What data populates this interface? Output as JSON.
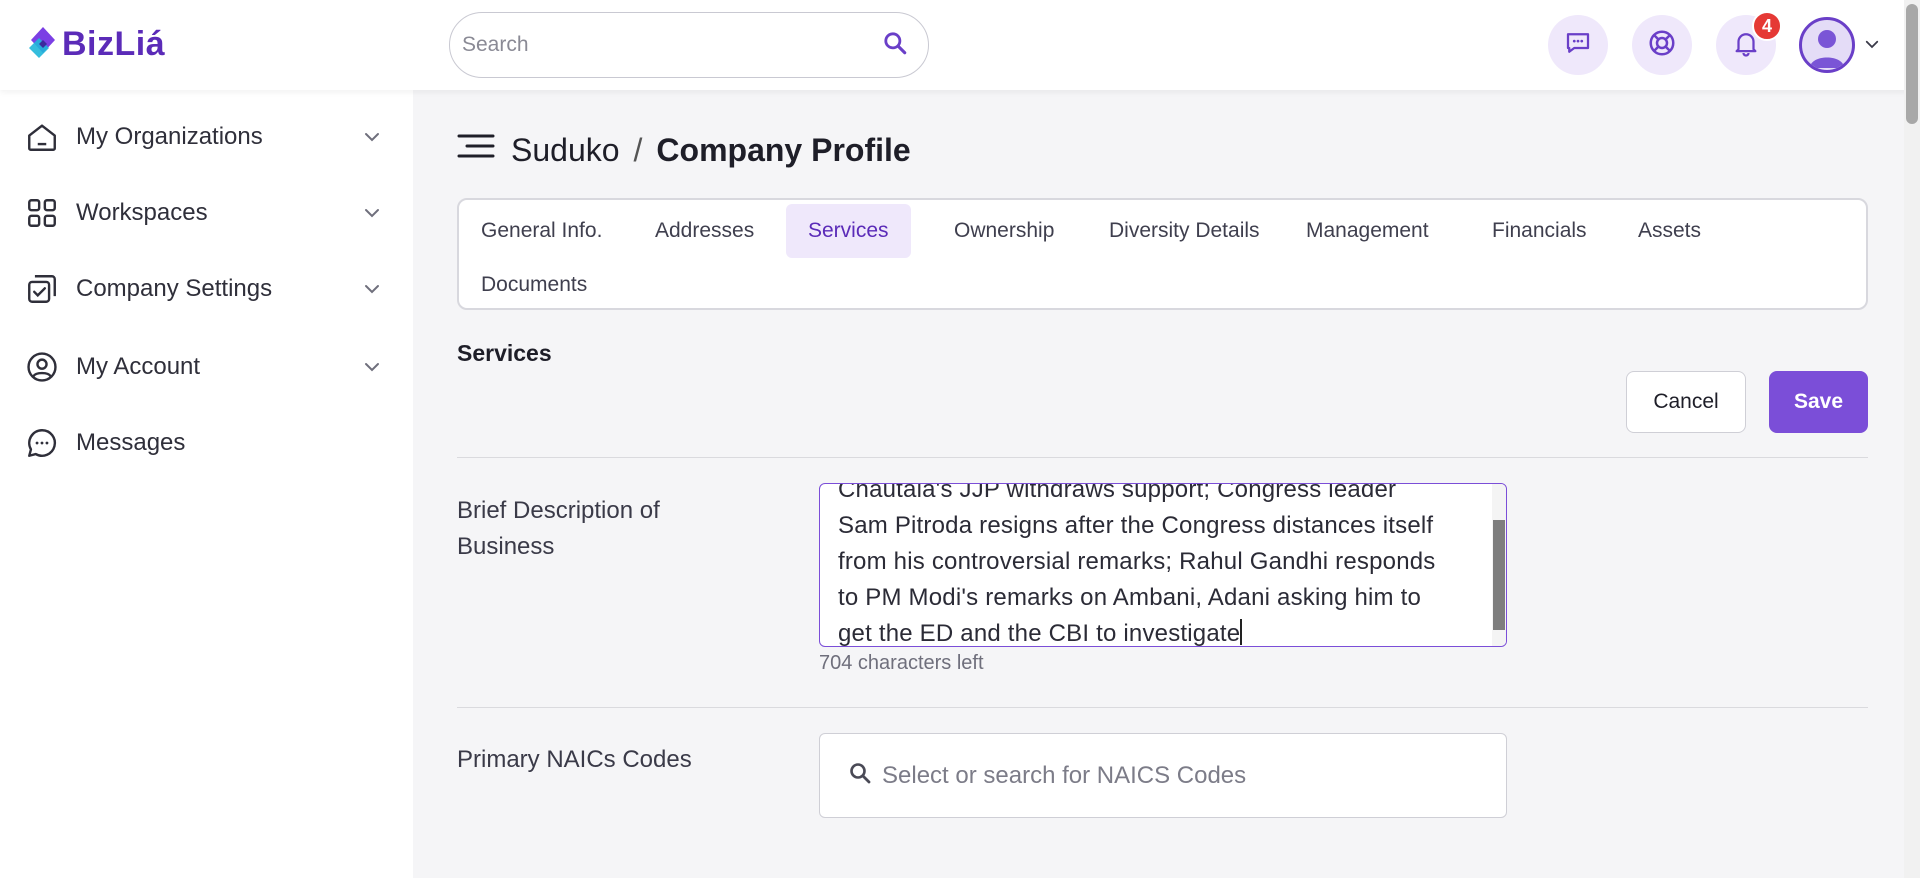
{
  "header": {
    "logo_text": "BizLiá",
    "search": {
      "placeholder": "Search",
      "value": ""
    },
    "notifications_count": "4",
    "icons": [
      "chat-icon",
      "support-icon",
      "bell-icon",
      "user-avatar",
      "chevron-down-icon"
    ]
  },
  "sidebar": {
    "items": [
      {
        "label": "My Organizations",
        "icon": "home-icon",
        "expandable": true
      },
      {
        "label": "Workspaces",
        "icon": "grid-icon",
        "expandable": true
      },
      {
        "label": "Company Settings",
        "icon": "settings-check-icon",
        "expandable": true
      },
      {
        "label": "My Account",
        "icon": "user-circle-icon",
        "expandable": true
      },
      {
        "label": "Messages",
        "icon": "message-icon",
        "expandable": false
      }
    ]
  },
  "breadcrumb": {
    "parent": "Suduko",
    "separator": "/",
    "current": "Company Profile"
  },
  "tabs": [
    {
      "label": "General Info.",
      "active": false
    },
    {
      "label": "Addresses",
      "active": false
    },
    {
      "label": "Services",
      "active": true
    },
    {
      "label": "Ownership",
      "active": false
    },
    {
      "label": "Diversity Details",
      "active": false
    },
    {
      "label": "Management",
      "active": false
    },
    {
      "label": "Financials",
      "active": false
    },
    {
      "label": "Assets",
      "active": false
    },
    {
      "label": "Documents",
      "active": false
    }
  ],
  "section": {
    "title": "Services",
    "cancel_label": "Cancel",
    "save_label": "Save"
  },
  "form": {
    "brief_label_line1": "Brief Description of",
    "brief_label_line2": "Business",
    "brief_lines": [
      "Chautala's JJP withdraws support; Congress leader",
      "Sam Pitroda resigns after the Congress distances itself",
      "from his controversial remarks; Rahul Gandhi responds",
      "to PM Modi's remarks on Ambani, Adani asking him to",
      "get the ED and the CBI to investigate"
    ],
    "chars_left": "704 characters left",
    "naics_label": "Primary NAICs Codes",
    "naics_placeholder": "Select or search for NAICS Codes"
  },
  "colors": {
    "accent": "#7b4ed8",
    "accent_light": "#efe8fb",
    "badge": "#e53935",
    "brand": "#5b2bb8"
  }
}
